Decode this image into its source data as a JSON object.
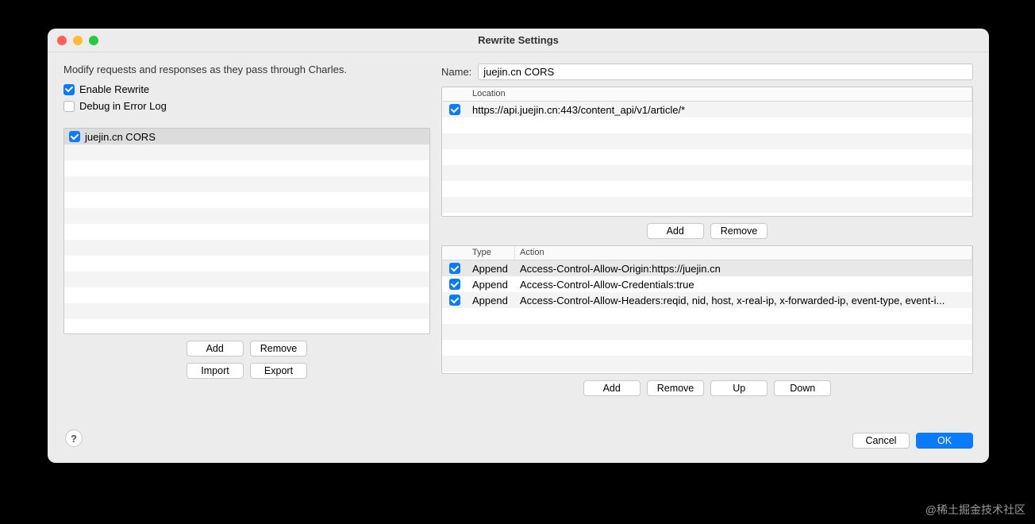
{
  "window": {
    "title": "Rewrite Settings"
  },
  "left": {
    "description": "Modify requests and responses as they pass through Charles.",
    "enable_label": "Enable Rewrite",
    "enable_checked": true,
    "debug_label": "Debug in Error Log",
    "debug_checked": false,
    "sets": [
      {
        "checked": true,
        "label": "juejin.cn CORS"
      }
    ],
    "buttons": {
      "add": "Add",
      "remove": "Remove",
      "import": "Import",
      "export": "Export"
    }
  },
  "right": {
    "name_label": "Name:",
    "name_value": "juejin.cn CORS",
    "locations": {
      "header": "Location",
      "rows": [
        {
          "checked": true,
          "url": "https://api.juejin.cn:443/content_api/v1/article/*"
        }
      ],
      "buttons": {
        "add": "Add",
        "remove": "Remove"
      }
    },
    "rules": {
      "header_type": "Type",
      "header_action": "Action",
      "rows": [
        {
          "checked": true,
          "type": "Append",
          "action": "Access-Control-Allow-Origin:https://juejin.cn"
        },
        {
          "checked": true,
          "type": "Append",
          "action": "Access-Control-Allow-Credentials:true"
        },
        {
          "checked": true,
          "type": "Append",
          "action": "Access-Control-Allow-Headers:reqid, nid, host, x-real-ip, x-forwarded-ip, event-type, event-i..."
        }
      ],
      "buttons": {
        "add": "Add",
        "remove": "Remove",
        "up": "Up",
        "down": "Down"
      }
    }
  },
  "footer": {
    "cancel": "Cancel",
    "ok": "OK",
    "help": "?"
  },
  "watermark": "@稀土掘金技术社区"
}
